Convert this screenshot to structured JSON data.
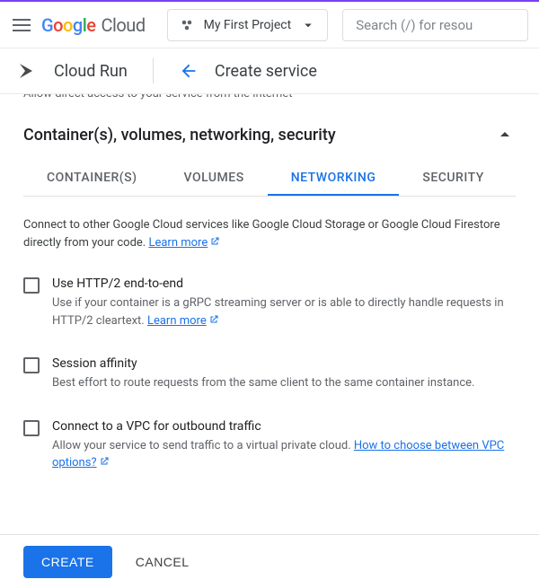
{
  "topbar": {
    "logo_google": "Google",
    "logo_cloud": "Cloud",
    "project_name": "My First Project",
    "search_placeholder": "Search (/) for resou"
  },
  "subheader": {
    "service_name": "Cloud Run",
    "page_title": "Create service"
  },
  "cutoff_text": "Allow direct access to your service from the internet",
  "section": {
    "title": "Container(s), volumes, networking, security"
  },
  "tabs": [
    {
      "label": "CONTAINER(S)",
      "active": false
    },
    {
      "label": "VOLUMES",
      "active": false
    },
    {
      "label": "NETWORKING",
      "active": true
    },
    {
      "label": "SECURITY",
      "active": false
    }
  ],
  "intro": {
    "text": "Connect to other Google Cloud services like Google Cloud Storage or Google Cloud Firestore directly from your code. ",
    "link": "Learn more"
  },
  "options": {
    "http2": {
      "label": "Use HTTP/2 end-to-end",
      "desc_pre": "Use if your container is a gRPC streaming server or is able to directly handle requests in HTTP/2 cleartext. ",
      "link": "Learn more"
    },
    "affinity": {
      "label": "Session affinity",
      "desc": "Best effort to route requests from the same client to the same container instance."
    },
    "vpc": {
      "label": "Connect to a VPC for outbound traffic",
      "desc_pre": "Allow your service to send traffic to a virtual private cloud. ",
      "link": "How to choose between VPC options?"
    }
  },
  "footer": {
    "create": "CREATE",
    "cancel": "CANCEL"
  }
}
